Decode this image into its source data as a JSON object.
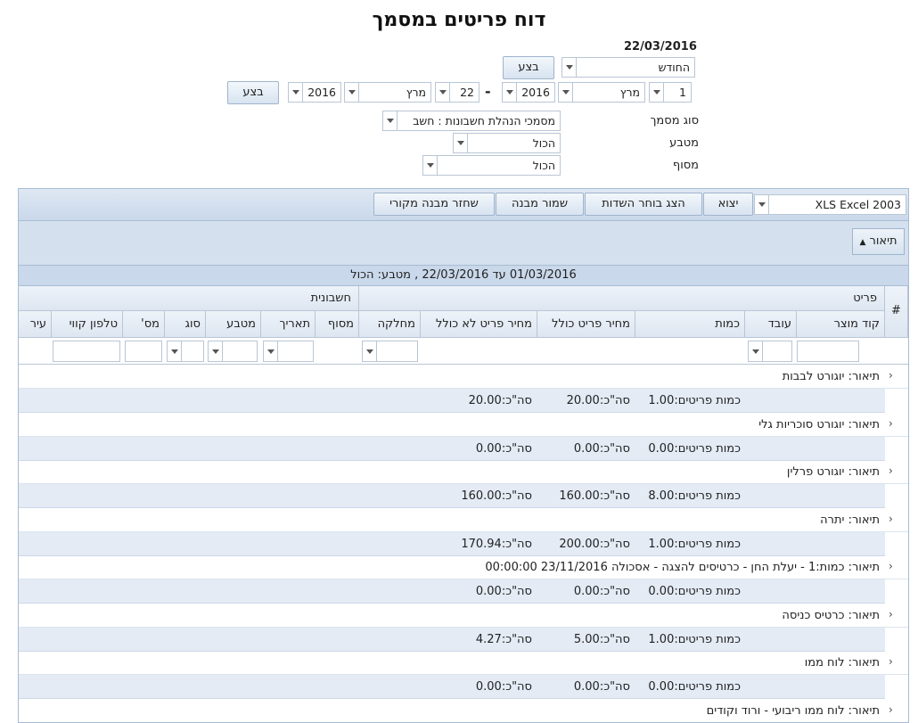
{
  "title": "דוח פריטים במסמך",
  "date": "22/03/2016",
  "period": {
    "value": "החודש",
    "exec": "בצע"
  },
  "range": {
    "from_day": "1",
    "from_month": "מרץ",
    "from_year": "2016",
    "to_day": "22",
    "to_month": "מרץ",
    "to_year": "2016",
    "exec": "בצע",
    "dash": "-"
  },
  "filters": {
    "doc_type_label": "סוג מסמך",
    "doc_type_value": "מסמכי הנהלת חשבונות : חשב",
    "currency_label": "מטבע",
    "currency_value": "הכול",
    "terminal_label": "מסוף",
    "terminal_value": "הכול"
  },
  "toolbar": {
    "export_format": "XLS Excel 2003",
    "export": "יצוא",
    "field_chooser": "הצג בוחר השדות",
    "save_layout": "שמור מבנה",
    "restore_layout": "שחזר מבנה מקורי"
  },
  "group_chip": "תיאור",
  "caption": "01/03/2016 עד 22/03/2016 , מטבע: הכול",
  "headers": {
    "hash": "#",
    "item_band": "פריט",
    "accounting_band": "חשבונית",
    "columns": [
      "קוד מוצר",
      "עובד",
      "כמות",
      "מחיר פריט כולל",
      "מחיר פריט לא כולל",
      "מחלקה",
      "מסוף",
      "תאריך",
      "מטבע",
      "סוג",
      "מס'",
      "טלפון קווי",
      "עיר"
    ]
  },
  "groups": [
    {
      "desc": "תיאור: יוגורט לבבות",
      "qty": "כמות פריטים:1.00",
      "sum1": "סה\"כ:20.00",
      "sum2": "סה\"כ:20.00"
    },
    {
      "desc": "תיאור: יוגורט סוכריות גלי",
      "qty": "כמות פריטים:0.00",
      "sum1": "סה\"כ:0.00",
      "sum2": "סה\"כ:0.00"
    },
    {
      "desc": "תיאור: יוגורט פרלין",
      "qty": "כמות פריטים:8.00",
      "sum1": "סה\"כ:160.00",
      "sum2": "סה\"כ:160.00"
    },
    {
      "desc": "תיאור: יתרה",
      "qty": "כמות פריטים:1.00",
      "sum1": "סה\"כ:200.00",
      "sum2": "סה\"כ:170.94"
    },
    {
      "desc": "תיאור: כמות:1 - יעלת החן - כרטיסים להצגה - אסכולה 23/11/2016 00:00:00",
      "qty": "כמות פריטים:0.00",
      "sum1": "סה\"כ:0.00",
      "sum2": "סה\"כ:0.00"
    },
    {
      "desc": "תיאור: כרטיס כניסה",
      "qty": "כמות פריטים:1.00",
      "sum1": "סה\"כ:5.00",
      "sum2": "סה\"כ:4.27"
    },
    {
      "desc": "תיאור: לוח ממו",
      "qty": "כמות פריטים:0.00",
      "sum1": "סה\"כ:0.00",
      "sum2": "סה\"כ:0.00"
    },
    {
      "desc": "תיאור: לוח ממו ריבועי - ורוד וקודים",
      "qty": "",
      "sum1": "",
      "sum2": ""
    }
  ]
}
